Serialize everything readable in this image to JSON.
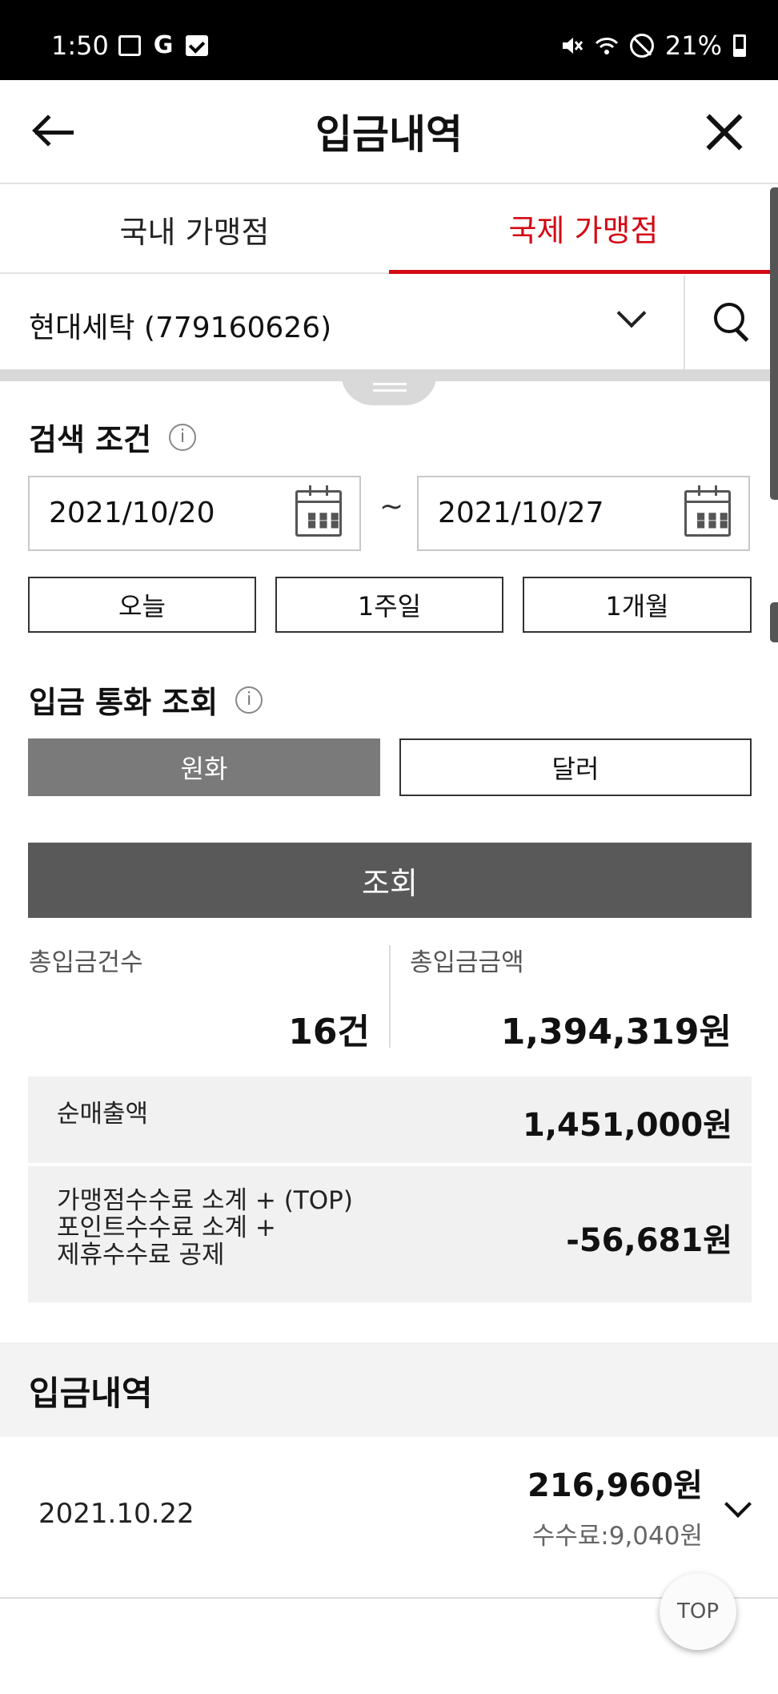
{
  "status_bar": {
    "time": "1:50",
    "battery": "21%",
    "notification_icons": [
      "image-icon",
      "google-icon",
      "checkbox-icon"
    ],
    "system_icons": [
      "mute-icon",
      "wifi-icon",
      "do-not-disturb-icon",
      "battery-icon"
    ],
    "google_letter": "G"
  },
  "header": {
    "title": "입금내역"
  },
  "tabs": [
    {
      "label": "국내 가맹점",
      "active": false
    },
    {
      "label": "국제 가맹점",
      "active": true
    }
  ],
  "merchant": {
    "selected": "현대세탁 (779160626)"
  },
  "search_conditions": {
    "title": "검색 조건",
    "info_glyph": "i",
    "start_date": "2021/10/20",
    "separator": "~",
    "end_date": "2021/10/27",
    "period_buttons": [
      "오늘",
      "1주일",
      "1개월"
    ]
  },
  "currency": {
    "title": "입금 통화 조회",
    "info_glyph": "i",
    "options": [
      {
        "label": "원화",
        "selected": true
      },
      {
        "label": "달러",
        "selected": false
      }
    ]
  },
  "search_button": "조회",
  "summary": {
    "count_label": "총입금건수",
    "count_value": "16건",
    "amount_label": "총입금금액",
    "amount_value": "1,394,319원",
    "net_sales_label": "순매출액",
    "net_sales_value": "1,451,000원",
    "fee_label_line1": "가맹점수수료 소계 + (TOP)",
    "fee_label_line2": "포인트수수료 소계 +",
    "fee_label_line3": "제휴수수료 공제",
    "fee_value": "-56,681원"
  },
  "history": {
    "title": "입금내역",
    "items": [
      {
        "date": "2021.10.22",
        "amount": "216,960원",
        "fee": "수수료:9,040원"
      }
    ]
  },
  "top_button": "TOP",
  "colors": {
    "accent_red": "#d40a15",
    "selected_gray": "#7a7a7a",
    "search_button": "#595959"
  }
}
